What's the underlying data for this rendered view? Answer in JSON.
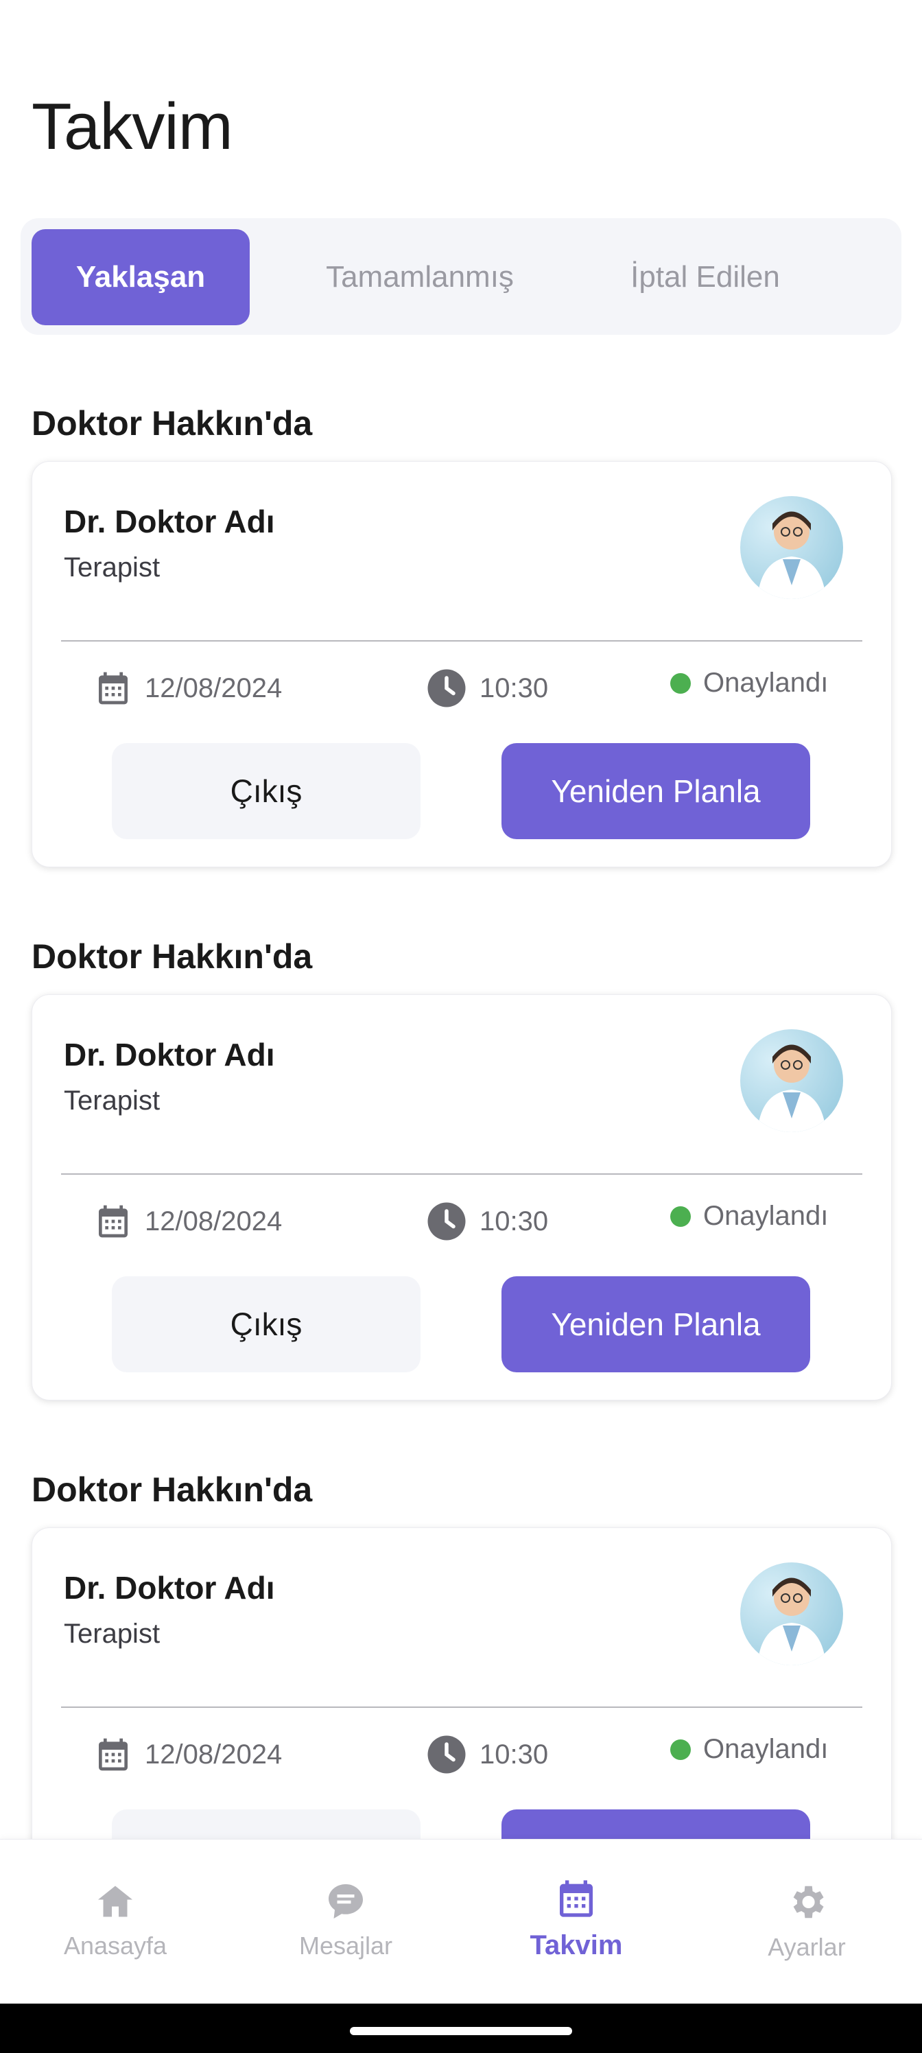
{
  "page": {
    "title": "Takvim"
  },
  "tabs": [
    {
      "label": "Yaklaşan",
      "active": true
    },
    {
      "label": "Tamamlanmış",
      "active": false
    },
    {
      "label": "İptal Edilen",
      "active": false
    }
  ],
  "appointments": [
    {
      "section_title": "Doktor Hakkın'da",
      "doctor_name": "Dr. Doktor Adı",
      "role": "Terapist",
      "date": "12/08/2024",
      "time": "10:30",
      "status": "Onaylandı",
      "exit_label": "Çıkış",
      "reschedule_label": "Yeniden Planla"
    },
    {
      "section_title": "Doktor Hakkın'da",
      "doctor_name": "Dr. Doktor Adı",
      "role": "Terapist",
      "date": "12/08/2024",
      "time": "10:30",
      "status": "Onaylandı",
      "exit_label": "Çıkış",
      "reschedule_label": "Yeniden Planla"
    },
    {
      "section_title": "Doktor Hakkın'da",
      "doctor_name": "Dr. Doktor Adı",
      "role": "Terapist",
      "date": "12/08/2024",
      "time": "10:30",
      "status": "Onaylandı",
      "exit_label": "Çıkış",
      "reschedule_label": "Yeniden Planla"
    }
  ],
  "bottom_nav": [
    {
      "label": "Anasayfa",
      "icon": "home-icon",
      "active": false
    },
    {
      "label": "Mesajlar",
      "icon": "message-icon",
      "active": false
    },
    {
      "label": "Takvim",
      "icon": "calendar-icon",
      "active": true
    },
    {
      "label": "Ayarlar",
      "icon": "gear-icon",
      "active": false
    }
  ],
  "colors": {
    "accent": "#7062d6",
    "status_ok": "#4caf50",
    "tab_bg": "#f4f5f9"
  }
}
